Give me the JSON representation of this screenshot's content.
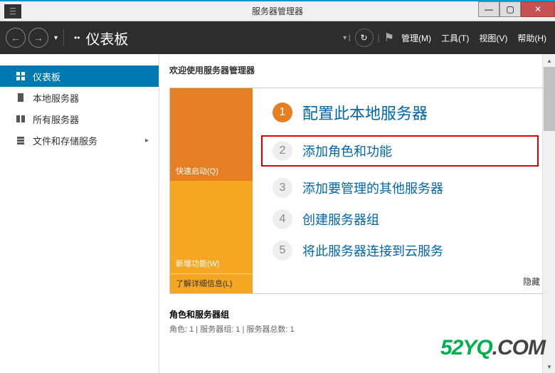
{
  "window": {
    "title": "服务器管理器"
  },
  "nav": {
    "breadcrumb": "••",
    "page_title": "仪表板",
    "menu": {
      "manage": "管理(M)",
      "tools": "工具(T)",
      "view": "视图(V)",
      "help": "帮助(H)"
    }
  },
  "sidebar": {
    "items": [
      {
        "label": "仪表板"
      },
      {
        "label": "本地服务器"
      },
      {
        "label": "所有服务器"
      },
      {
        "label": "文件和存储服务"
      }
    ]
  },
  "main": {
    "welcome": "欢迎使用服务器管理器",
    "left_blocks": {
      "quick_start": "快速启动(Q)",
      "whats_new": "新增功能(W)",
      "learn_more": "了解详细信息(L)"
    },
    "steps": [
      {
        "num": "1",
        "text": "配置此本地服务器"
      },
      {
        "num": "2",
        "text": "添加角色和功能"
      },
      {
        "num": "3",
        "text": "添加要管理的其他服务器"
      },
      {
        "num": "4",
        "text": "创建服务器组"
      },
      {
        "num": "5",
        "text": "将此服务器连接到云服务"
      }
    ],
    "hide": "隐藏",
    "roles": {
      "title": "角色和服务器组",
      "subtitle": "角色: 1 | 服务器组: 1 | 服务器总数: 1"
    }
  },
  "watermark": {
    "p1": "52YQ",
    "p2": ".COM"
  }
}
